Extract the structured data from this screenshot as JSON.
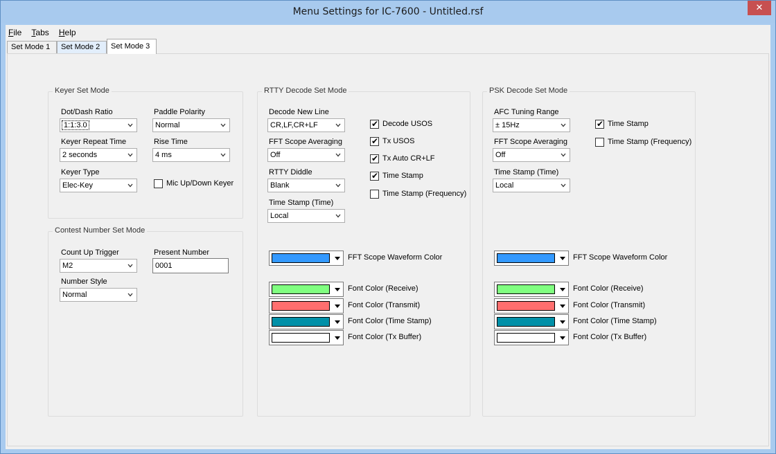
{
  "window": {
    "title": "Menu Settings for IC-7600 - Untitled.rsf",
    "close_glyph": "✕"
  },
  "menubar": {
    "file": {
      "ul": "F",
      "rest": "ile"
    },
    "tabs": {
      "ul": "T",
      "rest": "abs"
    },
    "help": {
      "ul": "H",
      "rest": "elp"
    }
  },
  "tabs": [
    "Set Mode 1",
    "Set Mode 2",
    "Set Mode 3"
  ],
  "active_tab": "Set Mode 3",
  "keyer": {
    "title": "Keyer Set Mode",
    "dot_dash_label": "Dot/Dash Ratio",
    "dot_dash_value": "1:1:3.0",
    "paddle_label": "Paddle Polarity",
    "paddle_value": "Normal",
    "repeat_label": "Keyer Repeat Time",
    "repeat_value": "2 seconds",
    "rise_label": "Rise Time",
    "rise_value": "4 ms",
    "type_label": "Keyer Type",
    "type_value": "Elec-Key",
    "mic_label": "Mic Up/Down Keyer",
    "mic_checked": false
  },
  "contest": {
    "title": "Contest Number Set Mode",
    "trigger_label": "Count Up Trigger",
    "trigger_value": "M2",
    "present_label": "Present Number",
    "present_value": "0001",
    "style_label": "Number Style",
    "style_value": "Normal"
  },
  "rtty": {
    "title": "RTTY Decode Set Mode",
    "newline_label": "Decode New Line",
    "newline_value": "CR,LF,CR+LF",
    "fft_avg_label": "FFT Scope Averaging",
    "fft_avg_value": "Off",
    "diddle_label": "RTTY Diddle",
    "diddle_value": "Blank",
    "ts_time_label": "Time Stamp (Time)",
    "ts_time_value": "Local",
    "checks": [
      {
        "label": "Decode USOS",
        "checked": true
      },
      {
        "label": "Tx USOS",
        "checked": true
      },
      {
        "label": "Tx Auto CR+LF",
        "checked": true
      },
      {
        "label": "Time Stamp",
        "checked": true
      },
      {
        "label": "Time Stamp (Frequency)",
        "checked": false
      }
    ],
    "waveform_label": "FFT Scope Waveform Color",
    "font_colors": [
      {
        "label": "Font Color (Receive)",
        "color": "#80ff80"
      },
      {
        "label": "Font Color (Transmit)",
        "color": "#ff6f6f"
      },
      {
        "label": "Font Color (Time Stamp)",
        "color": "#0090a8"
      },
      {
        "label": "Font Color (Tx Buffer)",
        "color": "#ffffff"
      }
    ],
    "waveform_color": "#3399ff"
  },
  "psk": {
    "title": "PSK Decode Set Mode",
    "afc_label": "AFC Tuning Range",
    "afc_value": "± 15Hz",
    "fft_avg_label": "FFT Scope Averaging",
    "fft_avg_value": "Off",
    "ts_time_label": "Time Stamp (Time)",
    "ts_time_value": "Local",
    "checks": [
      {
        "label": "Time Stamp",
        "checked": true
      },
      {
        "label": "Time Stamp (Frequency)",
        "checked": false
      }
    ],
    "waveform_label": "FFT Scope Waveform Color",
    "font_colors": [
      {
        "label": "Font Color (Receive)",
        "color": "#80ff80"
      },
      {
        "label": "Font Color (Transmit)",
        "color": "#ff6f6f"
      },
      {
        "label": "Font Color (Time Stamp)",
        "color": "#0090a8"
      },
      {
        "label": "Font Color (Tx Buffer)",
        "color": "#ffffff"
      }
    ],
    "waveform_color": "#3399ff"
  },
  "icons": {
    "check_glyph": "✔",
    "chevron": "chevron-down-icon",
    "dropdown": "triangle-down-icon"
  }
}
